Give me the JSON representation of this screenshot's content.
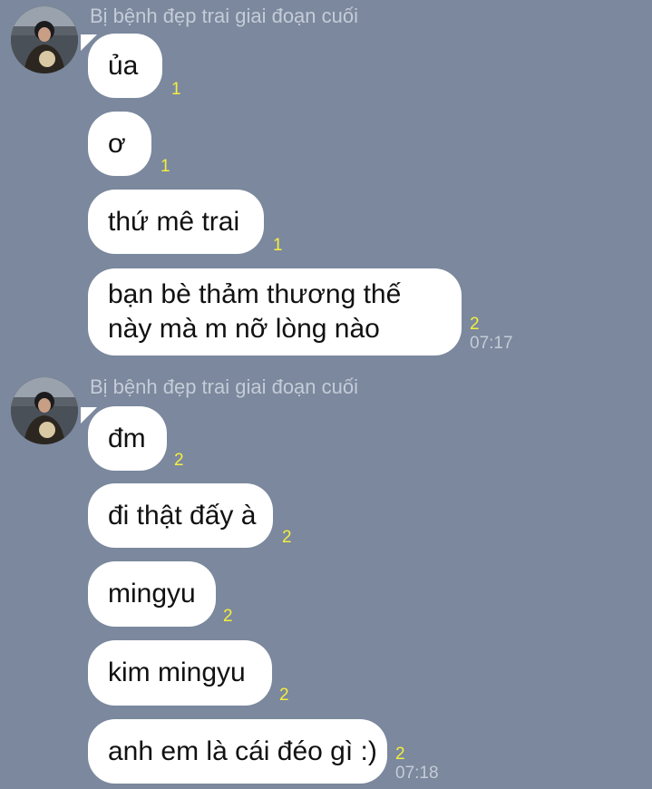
{
  "groups": [
    {
      "sender": "Bị bệnh đẹp trai giai đoạn cuối",
      "messages": [
        {
          "text": "ủa",
          "read": "1"
        },
        {
          "text": "ơ",
          "read": "1"
        },
        {
          "text": "thứ mê trai",
          "read": "1"
        },
        {
          "text": "bạn bè thảm thương thế này mà m nỡ lòng nào",
          "read": "2",
          "time": "07:17"
        }
      ]
    },
    {
      "sender": "Bị bệnh đẹp trai giai đoạn cuối",
      "messages": [
        {
          "text": "đm",
          "read": "2"
        },
        {
          "text": "đi thật đấy à",
          "read": "2"
        },
        {
          "text": "mingyu",
          "read": "2"
        },
        {
          "text": "kim mingyu",
          "read": "2"
        },
        {
          "text": "anh em là cái đéo gì :)",
          "read": "2",
          "time": "07:18"
        }
      ]
    }
  ],
  "colors": {
    "background": "#7b889d",
    "bubble": "#ffffff",
    "read_count": "#f4ee3e",
    "timestamp": "#c5ccd8"
  }
}
